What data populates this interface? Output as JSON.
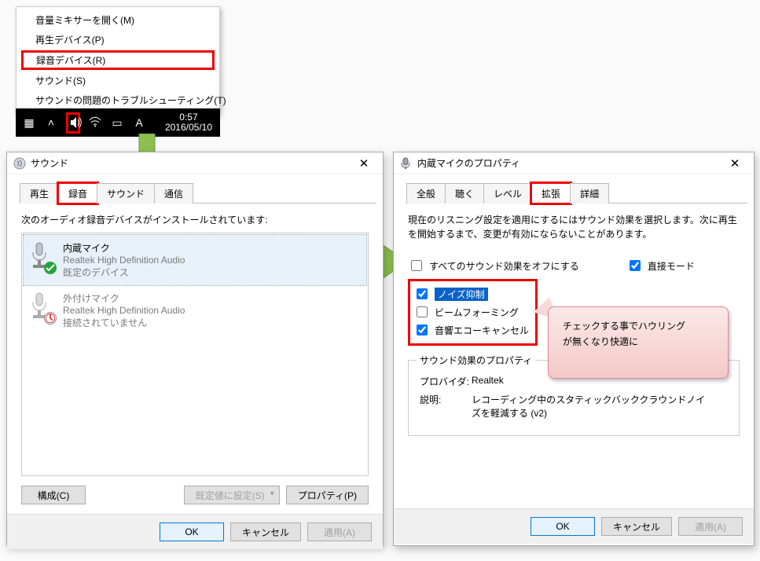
{
  "context_menu": {
    "items": [
      "音量ミキサーを開く(M)",
      "再生デバイス(P)",
      "録音デバイス(R)",
      "サウンド(S)",
      "サウンドの問題のトラブルシューティング(T)"
    ],
    "highlighted_index": 2
  },
  "taskbar": {
    "time": "0:57",
    "date": "2016/05/10",
    "icons": [
      "chart-icon",
      "up-icon",
      "speaker-icon",
      "wifi-icon",
      "messages-icon",
      "ime-a-icon"
    ]
  },
  "sound_window": {
    "title": "サウンド",
    "tabs": [
      "再生",
      "録音",
      "サウンド",
      "通信"
    ],
    "active_tab_index": 1,
    "instruction": "次のオーディオ録音デバイスがインストールされています:",
    "devices": [
      {
        "name": "内蔵マイク",
        "sub1": "Realtek High Definition Audio",
        "sub2": "既定のデバイス",
        "status": "ok",
        "selected": true
      },
      {
        "name": "外付けマイク",
        "sub1": "Realtek High Definition Audio",
        "sub2": "接続されていません",
        "status": "err",
        "selected": false
      }
    ],
    "btn_configure": "構成(C)",
    "btn_setdefault": "既定値に設定(S)",
    "btn_properties": "プロパティ(P)",
    "ok": "OK",
    "cancel": "キャンセル",
    "apply": "適用(A)"
  },
  "prop_window": {
    "title": "内蔵マイクのプロパティ",
    "tabs": [
      "全般",
      "聴く",
      "レベル",
      "拡張",
      "詳細"
    ],
    "active_tab_index": 3,
    "note": "現在のリスニング設定を適用にするにはサウンド効果を選択します。次に再生を開始するまで、変更が有効にならないことがあります。",
    "disable_all": {
      "label": "すべてのサウンド効果をオフにする",
      "checked": false
    },
    "direct_mode": {
      "label": "直接モード",
      "checked": true
    },
    "effects": [
      {
        "label": "ノイズ抑制",
        "checked": true,
        "highlight": true
      },
      {
        "label": "ビームフォーミング",
        "checked": false,
        "highlight": false
      },
      {
        "label": "音響エコーキャンセル",
        "checked": true,
        "highlight": false
      }
    ],
    "group_title": "サウンド効果のプロパティ",
    "provider_label": "プロバイダ:",
    "provider_value": "Realtek",
    "desc_label": "説明:",
    "desc_value": "レコーディング中のスタティックバッククラウンドノイズを軽減する (v2)",
    "ok": "OK",
    "cancel": "キャンセル",
    "apply": "適用(A)"
  },
  "callout": {
    "line1": "チェックする事でハウリング",
    "line2": "が無くなり快適に"
  }
}
